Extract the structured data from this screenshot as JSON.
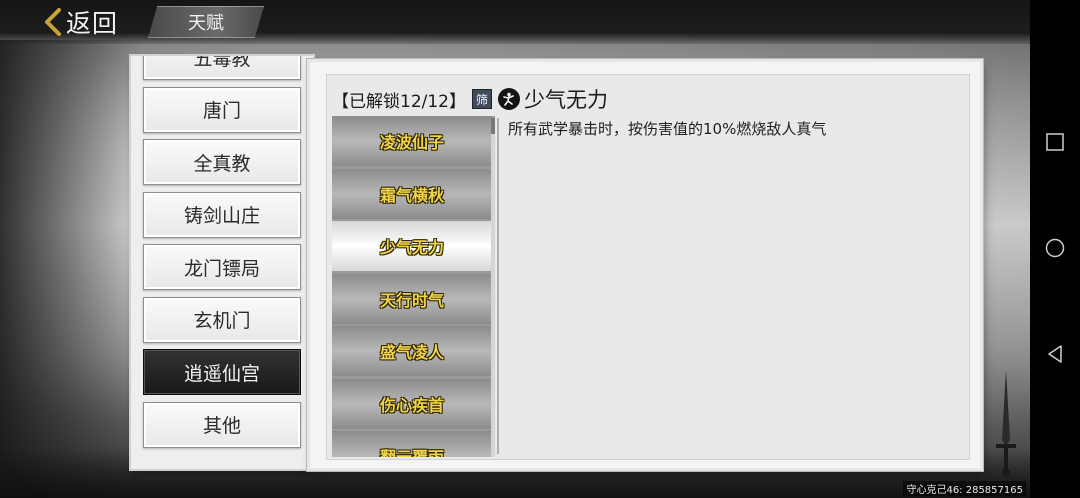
{
  "header": {
    "back_label": "返回",
    "title": "天赋"
  },
  "sects": [
    {
      "label": "五毒教"
    },
    {
      "label": "唐门"
    },
    {
      "label": "全真教"
    },
    {
      "label": "铸剑山庄"
    },
    {
      "label": "龙门镖局"
    },
    {
      "label": "玄机门"
    },
    {
      "label": "逍遥仙宫",
      "active": true
    },
    {
      "label": "其他"
    }
  ],
  "detail": {
    "unlock_label": "【已解锁12/12】",
    "filter_label": "筛",
    "skill_name": "少气无力",
    "description": "所有武学暴击时，按伤害值的10%燃烧敌人真气"
  },
  "talents": [
    {
      "label": "凌波仙子"
    },
    {
      "label": "霜气横秋"
    },
    {
      "label": "少气无力",
      "active": true
    },
    {
      "label": "天行时气"
    },
    {
      "label": "盛气凌人"
    },
    {
      "label": "伤心疾首"
    },
    {
      "label": "翻云覆雨"
    }
  ],
  "watermark": "守心克己46: 285857165",
  "colors": {
    "talent_text": "#f1d44a",
    "active_sect_bg": "#1f1f1f",
    "panel_bg": "#e9e9e9"
  }
}
